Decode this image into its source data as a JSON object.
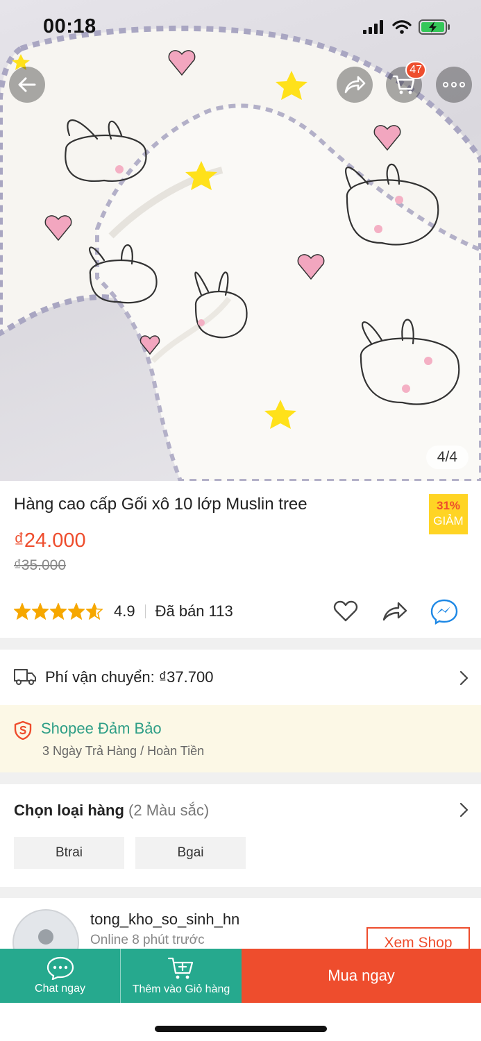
{
  "status_bar": {
    "time": "00:18",
    "icons": [
      "signal-icon",
      "wifi-icon",
      "battery-charging-icon"
    ]
  },
  "header": {
    "cart_count": "47",
    "image_counter": "4/4"
  },
  "product": {
    "title": "Hàng cao cấp Gối xô 10 lớp Muslin tree",
    "discount_percent": "31%",
    "discount_label": "GIẢM",
    "price": "₫24.000",
    "original_price": "₫35.000",
    "rating": "4.9",
    "rating_value": 4.6,
    "sold": "Đã bán 113"
  },
  "shipping": {
    "label": "Phí vận chuyển: ₫37.700"
  },
  "guarantee": {
    "title": "Shopee Đảm Bảo",
    "subtitle": "3 Ngày Trả Hàng / Hoàn Tiền"
  },
  "variation": {
    "heading": "Chọn loại hàng",
    "count": "(2 Màu sắc)",
    "options": [
      "Btrai",
      "Bgai"
    ]
  },
  "shop": {
    "name": "tong_kho_so_sinh_hn",
    "online": "Online 8 phút trước",
    "view_label": "Xem Shop"
  },
  "bottom_bar": {
    "chat_label": "Chat ngay",
    "add_cart_label": "Thêm vào Giỏ hàng",
    "buy_label": "Mua ngay"
  },
  "colors": {
    "accent": "#ee4d2d",
    "teal": "#26a98e",
    "star": "#f6a700",
    "guarantee_bg": "#fcf8e6"
  }
}
